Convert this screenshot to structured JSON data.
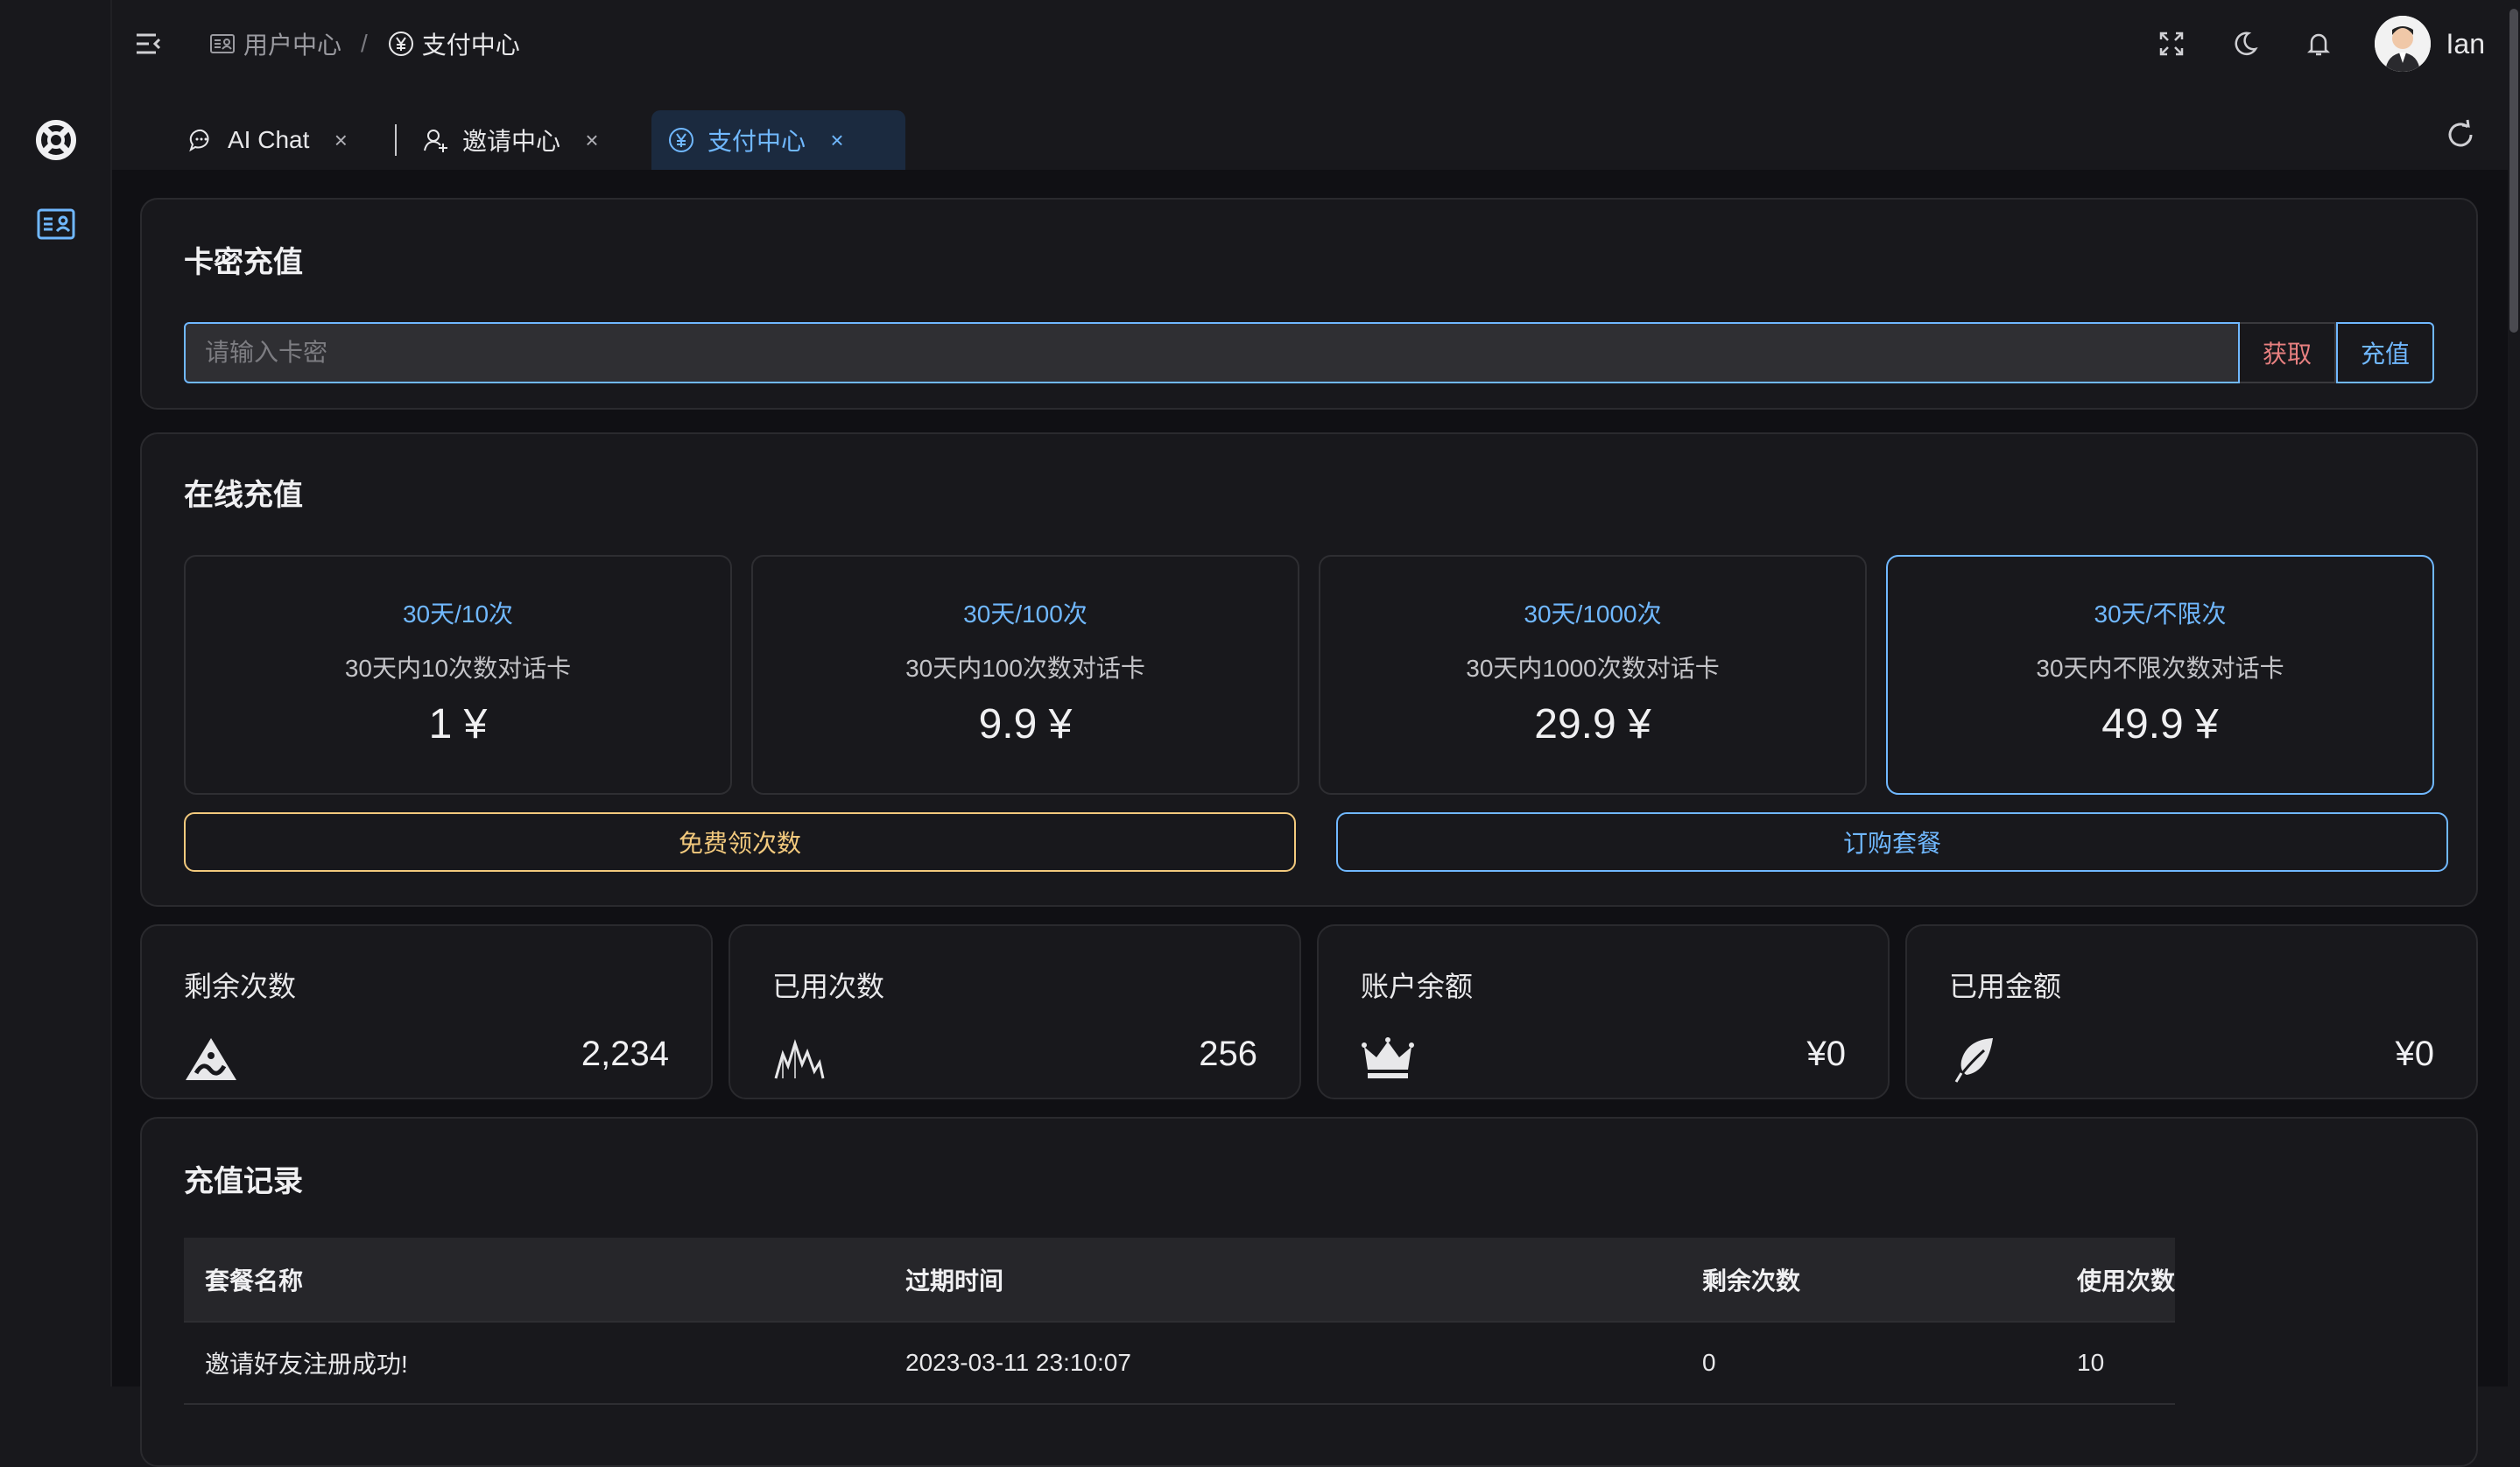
{
  "header": {
    "breadcrumb": [
      {
        "label": "用户中心",
        "icon": "id-card-icon"
      },
      {
        "label": "支付中心",
        "icon": "yen-circle-icon"
      }
    ],
    "separator": "/",
    "username": "Ian",
    "icons": [
      "menu-collapse-icon",
      "fullscreen-icon",
      "moon-icon",
      "bell-icon"
    ]
  },
  "tabs": [
    {
      "label": "AI Chat",
      "icon": "chat-bubble-icon",
      "close": "×",
      "active": false
    },
    {
      "label": "邀请中心",
      "icon": "user-add-icon",
      "close": "×",
      "active": false
    },
    {
      "label": "支付中心",
      "icon": "yen-circle-icon",
      "close": "×",
      "active": true
    }
  ],
  "card_secret": {
    "title": "卡密充值",
    "placeholder": "请输入卡密",
    "get_label": "获取",
    "recharge_label": "充值"
  },
  "online": {
    "title": "在线充值",
    "packages": [
      {
        "name": "30天/10次",
        "desc": "30天内10次数对话卡",
        "price": "1 ¥",
        "selected": false
      },
      {
        "name": "30天/100次",
        "desc": "30天内100次数对话卡",
        "price": "9.9 ¥",
        "selected": false
      },
      {
        "name": "30天/1000次",
        "desc": "30天内1000次数对话卡",
        "price": "29.9 ¥",
        "selected": false
      },
      {
        "name": "30天/不限次",
        "desc": "30天内不限次数对话卡",
        "price": "49.9 ¥",
        "selected": true
      }
    ],
    "free_label": "免费领次数",
    "order_label": "订购套餐"
  },
  "stats": [
    {
      "label": "剩余次数",
      "value": "2,234",
      "icon": "mountain-icon"
    },
    {
      "label": "已用次数",
      "value": "256",
      "icon": "peaks-icon"
    },
    {
      "label": "账户余额",
      "value": "¥0",
      "icon": "crown-icon"
    },
    {
      "label": "已用金额",
      "value": "¥0",
      "icon": "leaf-icon"
    }
  ],
  "records": {
    "title": "充值记录",
    "columns": [
      "套餐名称",
      "过期时间",
      "剩余次数",
      "使用次数"
    ],
    "rows": [
      [
        "邀请好友注册成功!",
        "2023-03-11 23:10:07",
        "0",
        "10"
      ]
    ]
  },
  "colors": {
    "accent": "#70b8ff",
    "warning": "#f2c97d",
    "danger": "#e88080",
    "background": "#101014",
    "card": "#18181c"
  }
}
